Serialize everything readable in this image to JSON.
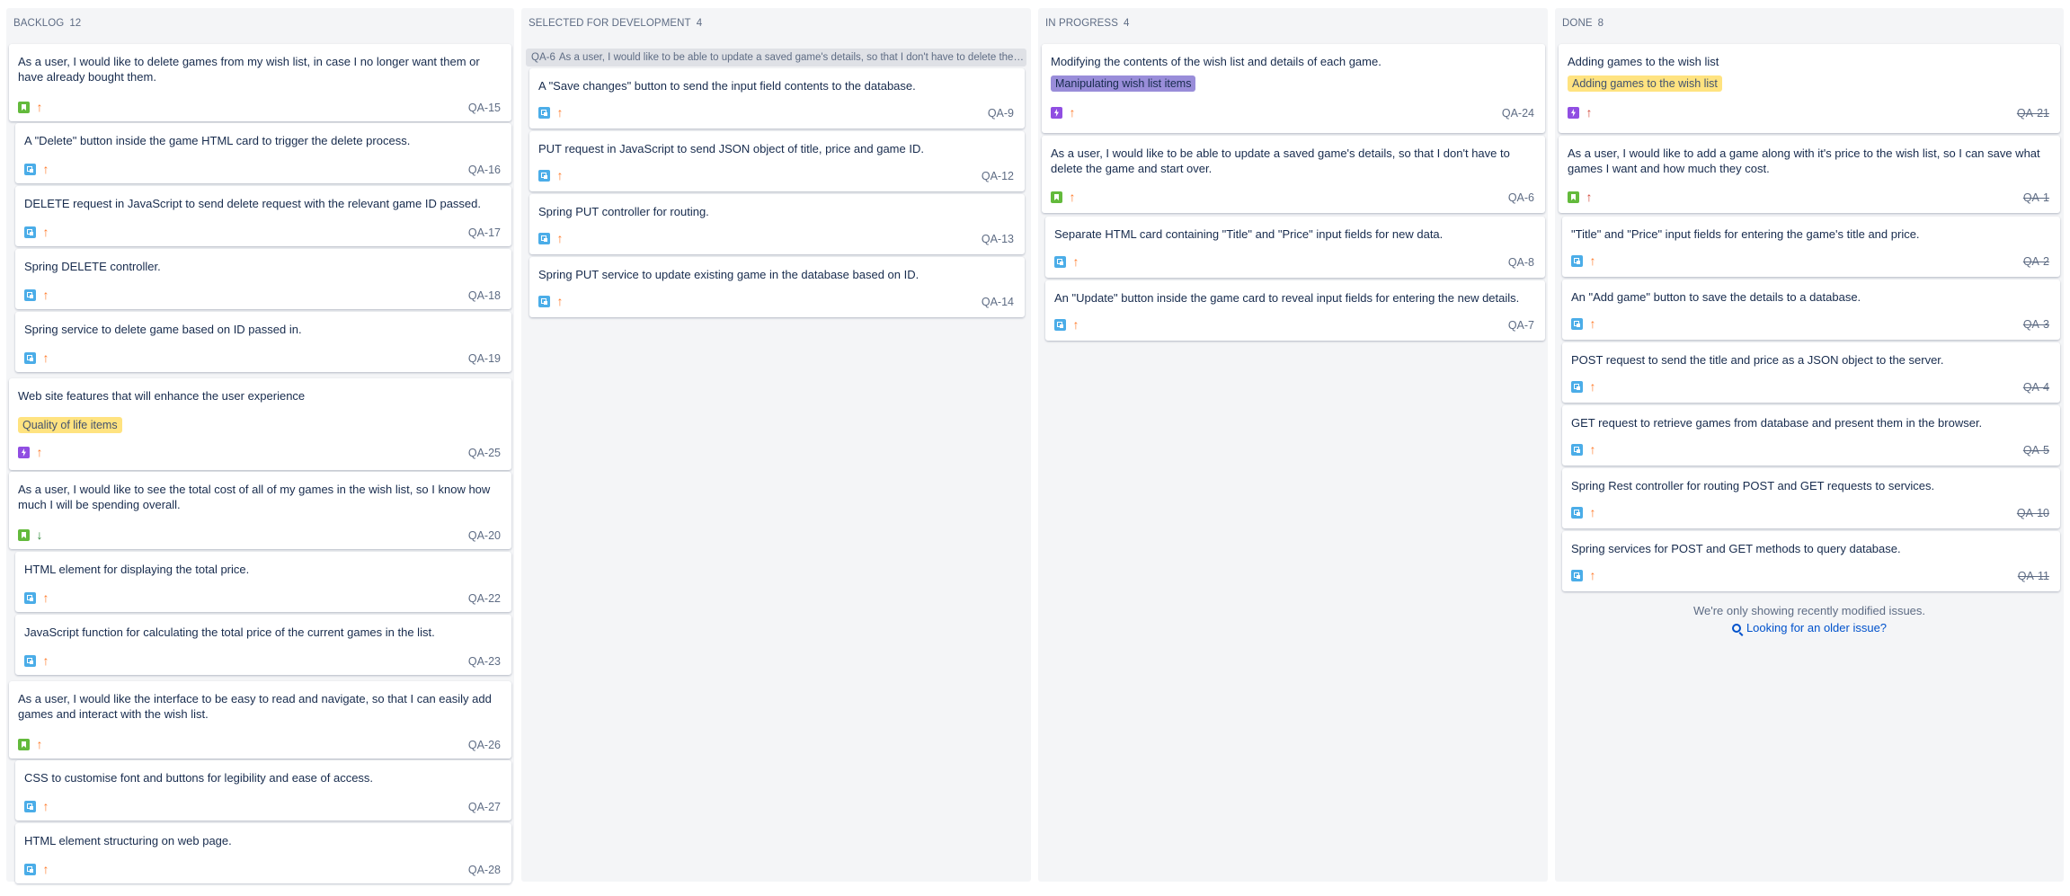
{
  "columns": {
    "backlog": {
      "name": "BACKLOG",
      "count": "12",
      "cards": [
        {
          "summary": "As a user, I would like to delete games from my wish list, in case I no longer want them or have already bought them.",
          "key": "QA-15"
        },
        {
          "summary": "A \"Delete\" button inside the game HTML card to trigger the delete process.",
          "key": "QA-16"
        },
        {
          "summary": "DELETE request in JavaScript to send delete request with the relevant game ID passed.",
          "key": "QA-17"
        },
        {
          "summary": "Spring DELETE controller.",
          "key": "QA-18"
        },
        {
          "summary": "Spring service to delete game based on ID passed in.",
          "key": "QA-19"
        },
        {
          "summary": "Web site features that will enhance the user experience",
          "epic": "Quality of life items",
          "key": "QA-25"
        },
        {
          "summary": "As a user, I would like to see the total cost of all of my games in the wish list, so I know how much I will be spending overall.",
          "key": "QA-20"
        },
        {
          "summary": "HTML element for displaying the total price.",
          "key": "QA-22"
        },
        {
          "summary": "JavaScript function for calculating the total price of the current games in the list.",
          "key": "QA-23"
        },
        {
          "summary": "As a user, I would like the interface to be easy to read and navigate, so that I can easily add games and interact with the wish list.",
          "key": "QA-26"
        },
        {
          "summary": "CSS to customise font and buttons for legibility and ease of access.",
          "key": "QA-27"
        },
        {
          "summary": "HTML element structuring on web page.",
          "key": "QA-28"
        }
      ]
    },
    "selected": {
      "name": "SELECTED FOR DEVELOPMENT",
      "count": "4",
      "parent": {
        "key": "QA-6",
        "summary": "As a user, I would like to be able to update a saved game's details, so that I don't have to delete the game ..."
      },
      "cards": [
        {
          "summary": "A \"Save changes\" button to send the input field contents to the database.",
          "key": "QA-9"
        },
        {
          "summary": "PUT request in JavaScript to send JSON object of title, price and game ID.",
          "key": "QA-12"
        },
        {
          "summary": "Spring PUT controller for routing.",
          "key": "QA-13"
        },
        {
          "summary": "Spring PUT service to update existing game in the database based on ID.",
          "key": "QA-14"
        }
      ]
    },
    "progress": {
      "name": "IN PROGRESS",
      "count": "4",
      "cards": [
        {
          "summary": "Modifying the contents of the wish list and details of each game.",
          "epic": "Manipulating wish list items",
          "key": "QA-24"
        },
        {
          "summary": "As a user, I would like to be able to update a saved game's details, so that I don't have to delete the game and start over.",
          "key": "QA-6"
        },
        {
          "summary": "Separate HTML card containing \"Title\" and \"Price\" input fields for new data.",
          "key": "QA-8"
        },
        {
          "summary": "An \"Update\" button inside the game card to reveal input fields for entering the new details.",
          "key": "QA-7"
        }
      ]
    },
    "done": {
      "name": "DONE",
      "count": "8",
      "cards": [
        {
          "summary": "Adding games to the wish list",
          "epic": "Adding games to the wish list",
          "key": "QA-21"
        },
        {
          "summary": "As a user, I would like to add a game along with it's price to the wish list, so I can save what games I want and how much they cost.",
          "key": "QA-1"
        },
        {
          "summary": "\"Title\" and \"Price\" input fields for entering the game's title and price.",
          "key": "QA-2"
        },
        {
          "summary": "An \"Add game\" button to save the details to a database.",
          "key": "QA-3"
        },
        {
          "summary": "POST request to send the title and price as a JSON object to the server.",
          "key": "QA-4"
        },
        {
          "summary": "GET request to retrieve games from database and present them in the browser.",
          "key": "QA-5"
        },
        {
          "summary": "Spring Rest controller for routing POST and GET requests to services.",
          "key": "QA-10"
        },
        {
          "summary": "Spring services for POST and GET methods to query database.",
          "key": "QA-11"
        }
      ],
      "note": "We're only showing recently modified issues.",
      "link": "Looking for an older issue?"
    }
  },
  "colors": {
    "story": "#63ba3c",
    "subtask": "#4bade8",
    "epic": "#904ee2",
    "priority_medium": "#ff7a29",
    "priority_high": "#d04437",
    "priority_low": "#2a8735",
    "epic_yellow": "#ffe380",
    "epic_purple": "#998dd9",
    "highlight": "#deebff"
  },
  "icons": {
    "story": "story-bookmark-icon",
    "subtask": "subtask-icon",
    "epic": "epic-lightning-icon",
    "priority_medium": "priority-medium-arrow-up-icon",
    "priority_high": "priority-high-arrow-up-icon",
    "priority_low": "priority-low-arrow-down-icon",
    "search": "search-icon"
  }
}
